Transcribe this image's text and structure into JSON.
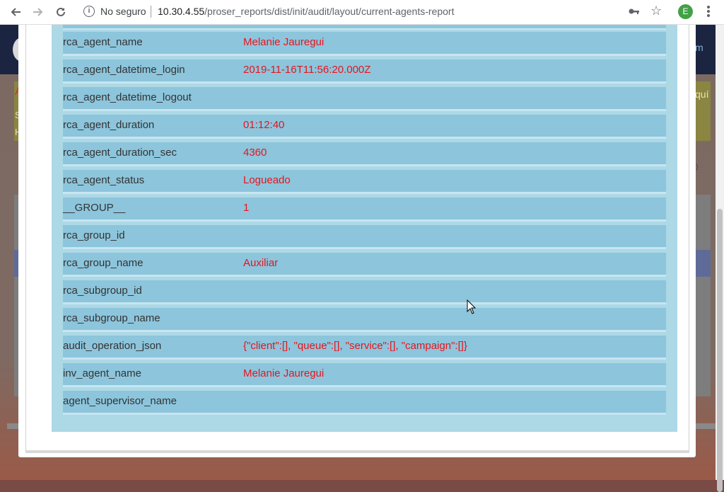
{
  "browser": {
    "security_label": "No seguro",
    "url_host": "10.30.4.55",
    "url_path": "/proser_reports/dist/init/audit/layout/current-agents-report",
    "profile_initial": "E"
  },
  "background_page": {
    "header_right_text": "m",
    "alert_right_text": "quí",
    "alert_char_1": "A",
    "alert_char_2": "S",
    "alert_char_3": "H",
    "select_right_text": "0"
  },
  "detail": {
    "rows": [
      {
        "key": "rca_agent_name",
        "value": "Melanie Jauregui"
      },
      {
        "key": "rca_agent_datetime_login",
        "value": "2019-11-16T11:56:20.000Z"
      },
      {
        "key": "rca_agent_datetime_logout",
        "value": ""
      },
      {
        "key": "rca_agent_duration",
        "value": "01:12:40"
      },
      {
        "key": "rca_agent_duration_sec",
        "value": "4360"
      },
      {
        "key": "rca_agent_status",
        "value": "Logueado"
      },
      {
        "key": "__GROUP__",
        "value": "1"
      },
      {
        "key": "rca_group_id",
        "value": ""
      },
      {
        "key": "rca_group_name",
        "value": "Auxiliar"
      },
      {
        "key": "rca_subgroup_id",
        "value": ""
      },
      {
        "key": "rca_subgroup_name",
        "value": ""
      },
      {
        "key": "audit_operation_json",
        "value": "{\"client\":[], \"queue\":[], \"service\":[], \"campaign\":[]}"
      },
      {
        "key": "inv_agent_name",
        "value": "Melanie Jauregui"
      },
      {
        "key": "agent_supervisor_name",
        "value": ""
      }
    ]
  },
  "colors": {
    "key_text": "#333333",
    "value_text": "#e8141c",
    "row_bg": "#8cc5dc",
    "panel_bg": "#add8e6"
  }
}
